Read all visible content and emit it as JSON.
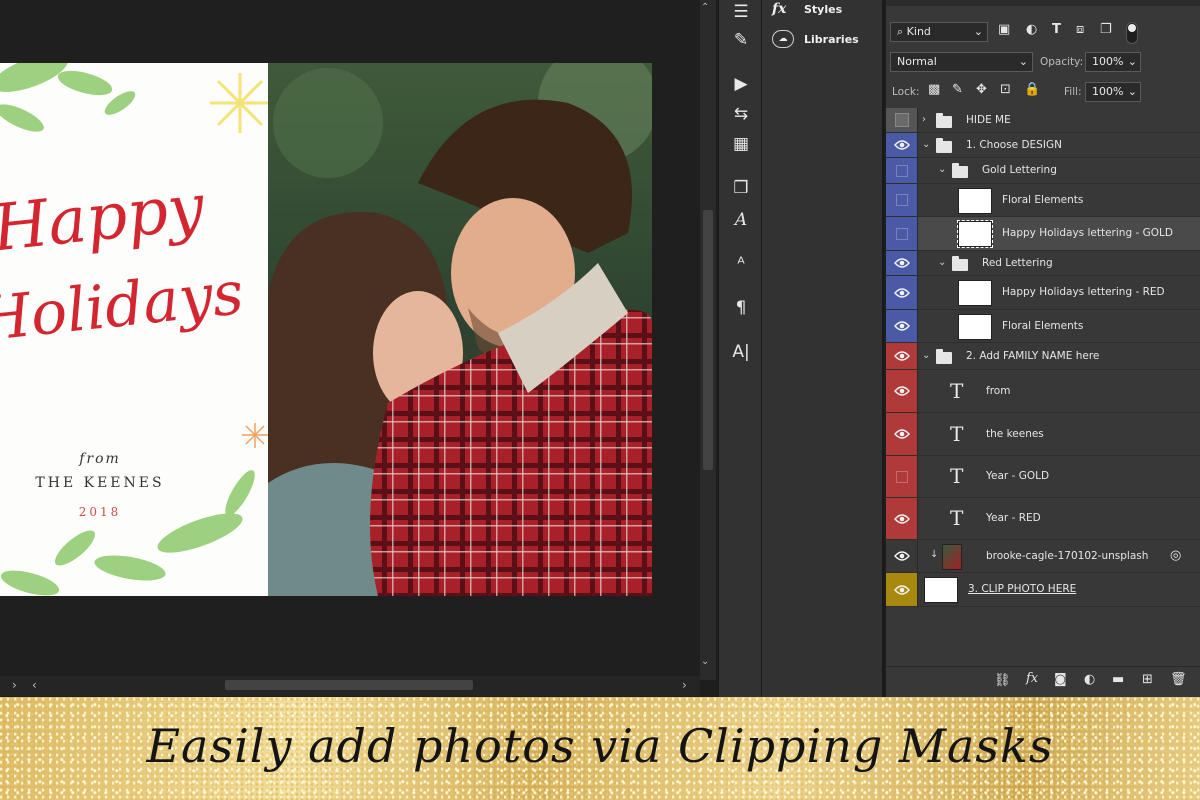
{
  "mini_panel": {
    "styles_label": "Styles",
    "libraries_label": "Libraries"
  },
  "layers_panel": {
    "filter_kind": "Kind",
    "blend_mode": "Normal",
    "opacity_label": "Opacity:",
    "opacity_value": "100%",
    "lock_label": "Lock:",
    "fill_label": "Fill:",
    "fill_value": "100%",
    "layers": [
      {
        "name": "HIDE ME",
        "type": "folder",
        "eye_color": "#555555",
        "visible": false
      },
      {
        "name": "1. Choose DESIGN",
        "type": "folder",
        "eye_color": "#4a5aa6",
        "visible": true
      },
      {
        "name": "Gold Lettering",
        "type": "folder",
        "eye_color": "#4a5aa6",
        "visible": false
      },
      {
        "name": "Floral Elements",
        "type": "image",
        "eye_color": "#4a5aa6",
        "visible": false
      },
      {
        "name": "Happy Holidays lettering - GOLD",
        "type": "image",
        "eye_color": "#4a5aa6",
        "visible": false
      },
      {
        "name": "Red Lettering",
        "type": "folder",
        "eye_color": "#4a5aa6",
        "visible": true
      },
      {
        "name": "Happy Holidays lettering - RED",
        "type": "image",
        "eye_color": "#4a5aa6",
        "visible": true
      },
      {
        "name": "Floral Elements",
        "type": "image",
        "eye_color": "#4a5aa6",
        "visible": true
      },
      {
        "name": "2. Add FAMILY NAME here",
        "type": "folder",
        "eye_color": "#b03a3a",
        "visible": true
      },
      {
        "name": "from",
        "type": "text",
        "eye_color": "#b03a3a",
        "visible": true
      },
      {
        "name": "the keenes",
        "type": "text",
        "eye_color": "#b03a3a",
        "visible": true
      },
      {
        "name": "Year - GOLD",
        "type": "text",
        "eye_color": "#b03a3a",
        "visible": false
      },
      {
        "name": "Year - RED",
        "type": "text",
        "eye_color": "#b03a3a",
        "visible": true
      },
      {
        "name": "brooke-cagle-170102-unsplash",
        "type": "image",
        "eye_color": "#383838",
        "visible": true
      },
      {
        "name": "3. CLIP PHOTO HERE",
        "type": "shape",
        "eye_color": "#a8880f",
        "visible": true
      }
    ]
  },
  "card": {
    "line1": "Happy",
    "line2": "Holidays",
    "from": "from",
    "family": "THE KEENES",
    "year": "2018",
    "script_color": "#d42630",
    "year_color": "#d4484a"
  },
  "banner": {
    "text": "Easily add photos via Clipping Masks"
  }
}
